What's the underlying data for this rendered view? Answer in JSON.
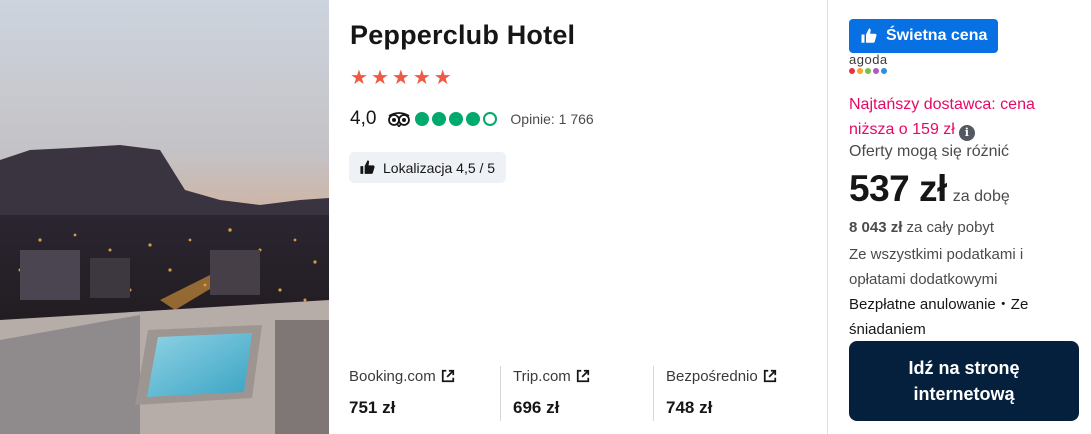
{
  "hotel": {
    "name": "Pepperclub Hotel",
    "star_count": 5,
    "rating_value": "4,0",
    "bubble_rating": 4,
    "bubble_max": 5,
    "reviews_text": "Opinie: 1 766",
    "location_badge": "Lokalizacja 4,5 / 5"
  },
  "providers": [
    {
      "name": "Booking.com",
      "price": "751 zł"
    },
    {
      "name": "Trip.com",
      "price": "696 zł"
    },
    {
      "name": "Bezpośrednio",
      "price": "748 zł"
    }
  ],
  "deal": {
    "badge_label": "Świetna cena",
    "provider_logo_text": "agoda",
    "provider_logo_colors": [
      "#e8333b",
      "#f5a623",
      "#7ac043",
      "#b258c4",
      "#2f8fe0"
    ],
    "cheapest_text": "Najtańszy dostawca: cena niższa o 159 zł",
    "info_glyph": "i",
    "offers_vary": "Oferty mogą się różnić",
    "price": "537 zł",
    "per_night": "za dobę",
    "total_amount": "8 043 zł",
    "total_suffix": " za cały pobyt",
    "taxes_text": "Ze wszystkimi podatkami i opłatami dodatkowymi",
    "amenities_text": "Bezpłatne anulowanie・Ze śniadaniem",
    "cta_label": "Idź na stronę internetową"
  },
  "colors": {
    "accent_blue": "#0770e3",
    "cta_dark": "#05203c",
    "star_red": "#ef5a44",
    "tripadvisor_green": "#00aa6c",
    "cheapest_pink": "#e70866"
  },
  "icons": {
    "hotel_photo": "hotel-rooftop-pool-photo",
    "tripadvisor": "tripadvisor-owl-icon",
    "thumbs_up": "thumbs-up-icon",
    "external_link": "external-link-icon",
    "info": "info-icon"
  }
}
